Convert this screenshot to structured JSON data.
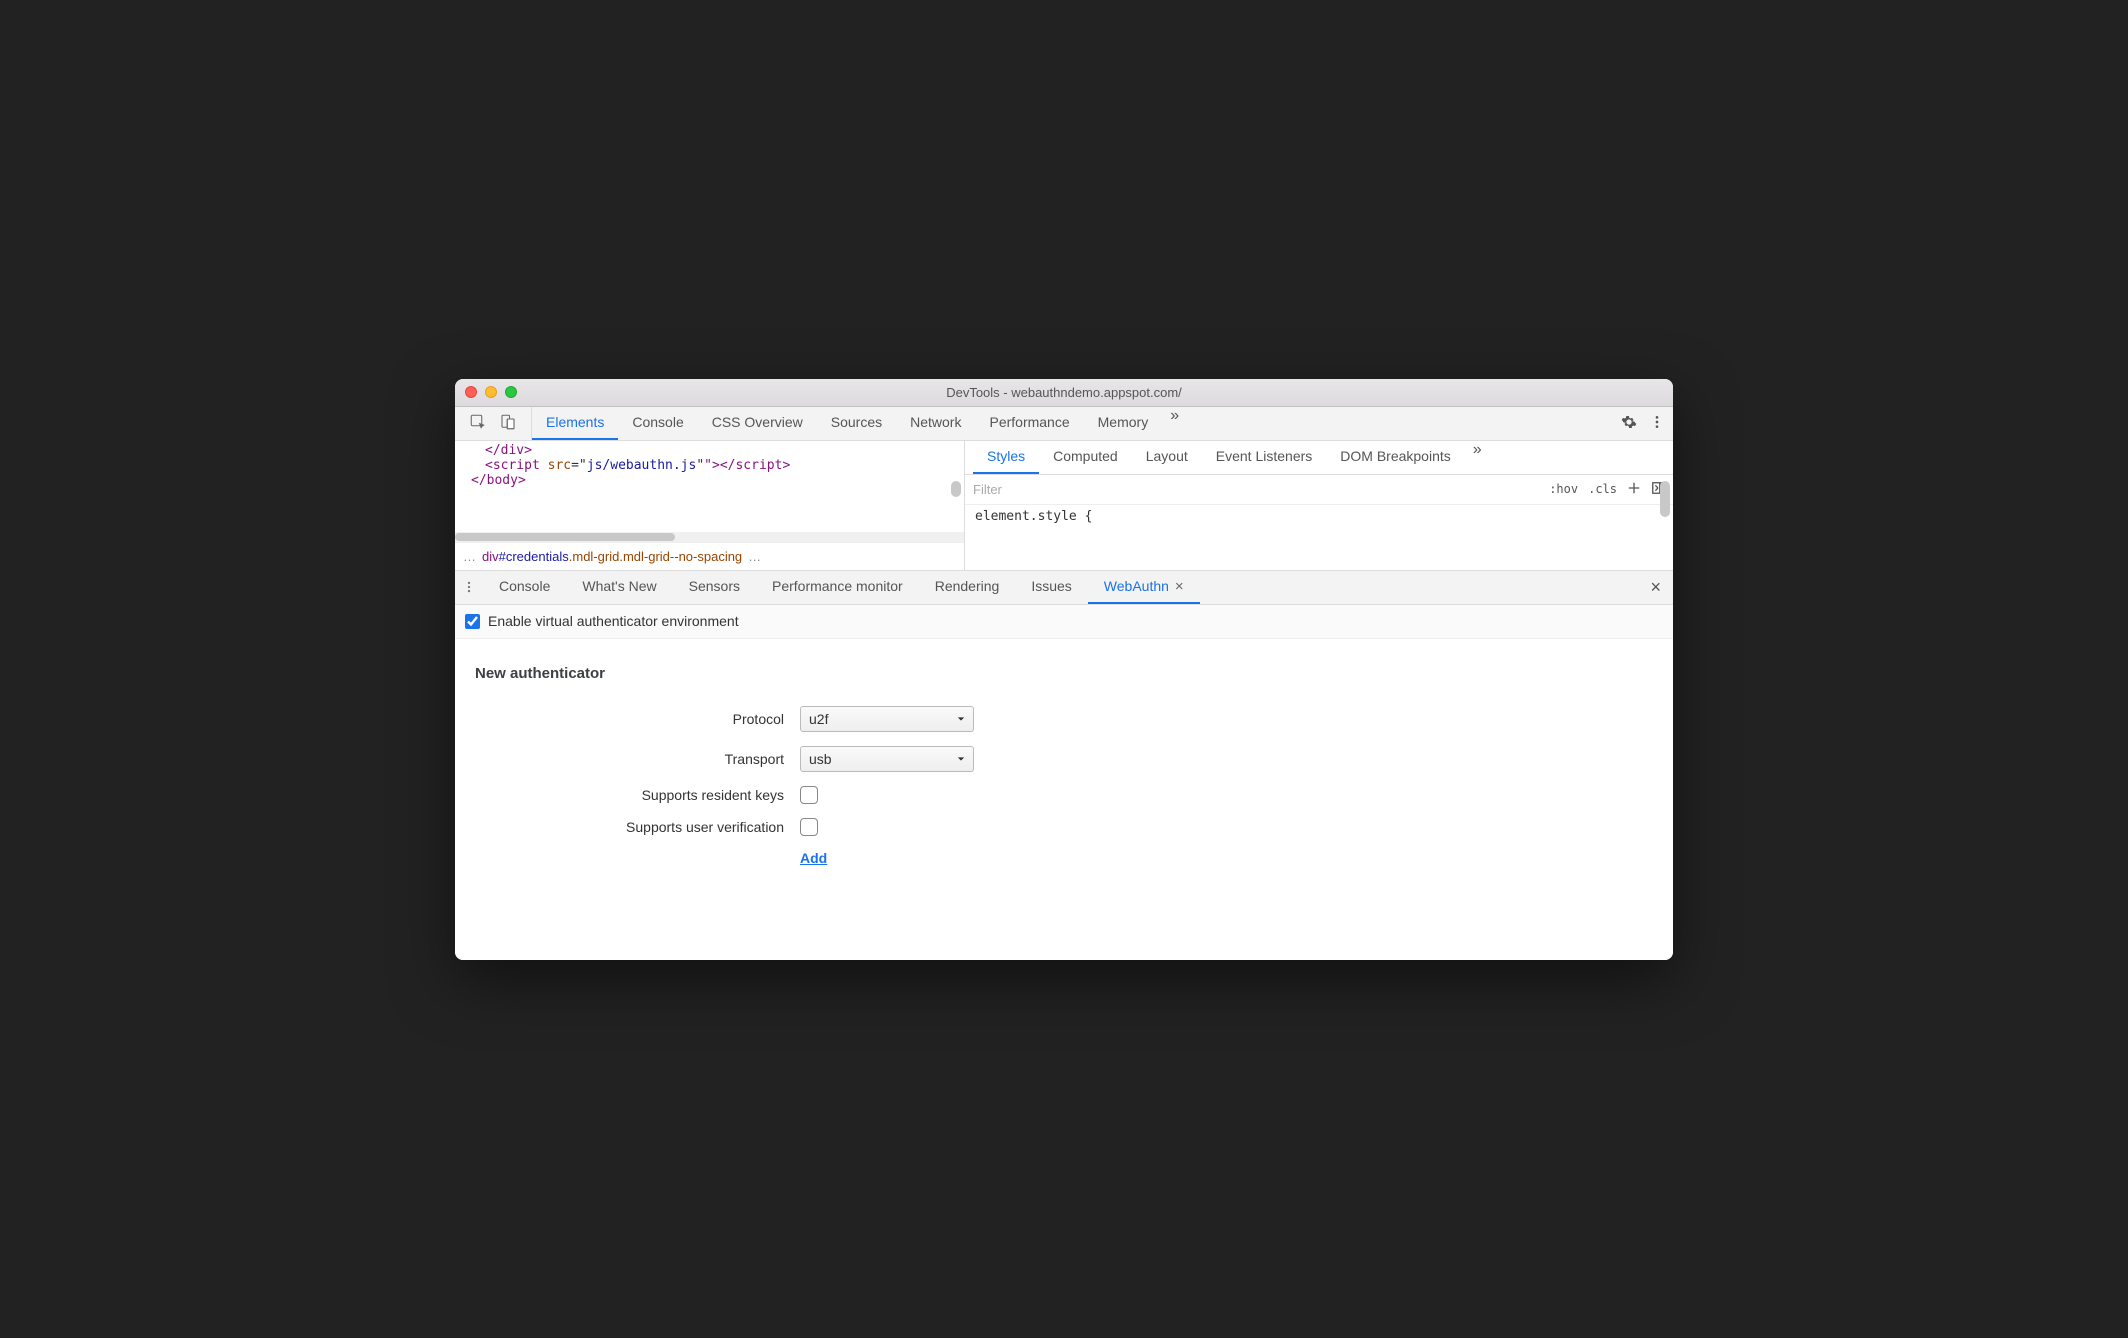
{
  "window": {
    "title": "DevTools - webauthndemo.appspot.com/"
  },
  "main_tabs": [
    "Elements",
    "Console",
    "CSS Overview",
    "Sources",
    "Network",
    "Performance",
    "Memory"
  ],
  "active_main_tab": "Elements",
  "code": {
    "line1_tag": "</div>",
    "line2_open": "<script ",
    "line2_attr": "src",
    "line2_eq": "=\"",
    "line2_val": "js/webauthn.js",
    "line2_close": "\"></scr",
    "line2_close2": "ipt>",
    "line3_tag": "</body>"
  },
  "breadcrumb": {
    "prefix": "…",
    "div": "div",
    "id": "#credentials",
    "dot1": ".",
    "cls1": "mdl-grid",
    "dot2": ".",
    "cls2": "mdl-grid--no-spacing",
    "suffix": "…"
  },
  "sub_tabs": [
    "Styles",
    "Computed",
    "Layout",
    "Event Listeners",
    "DOM Breakpoints"
  ],
  "active_sub_tab": "Styles",
  "filter": {
    "placeholder": "Filter",
    "hov": ":hov",
    "cls": ".cls"
  },
  "style_body": "element.style {",
  "drawer_tabs": [
    "Console",
    "What's New",
    "Sensors",
    "Performance monitor",
    "Rendering",
    "Issues",
    "WebAuthn"
  ],
  "active_drawer_tab": "WebAuthn",
  "enable_label": "Enable virtual authenticator environment",
  "form": {
    "section_title": "New authenticator",
    "protocol_label": "Protocol",
    "protocol_value": "u2f",
    "transport_label": "Transport",
    "transport_value": "usb",
    "resident_label": "Supports resident keys",
    "verify_label": "Supports user verification",
    "add_label": "Add"
  }
}
